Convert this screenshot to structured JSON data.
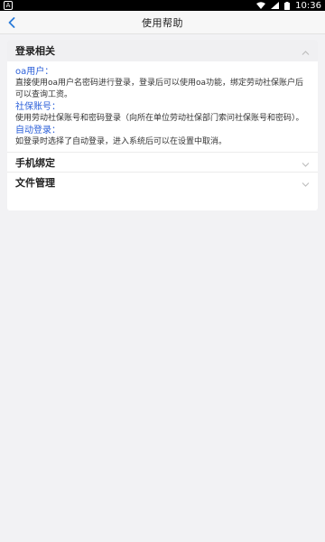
{
  "status_bar": {
    "indicator": "A",
    "time": "10:36",
    "icons": [
      "wifi-icon",
      "signal-icon",
      "battery-icon"
    ]
  },
  "nav": {
    "title": "使用帮助",
    "back_icon": "chevron-left-icon"
  },
  "sections": {
    "login": {
      "title": "登录相关",
      "expanded": true,
      "items": [
        {
          "term": "oa用户：",
          "desc": "直接使用oa用户名密码进行登录，登录后可以使用oa功能，绑定劳动社保账户后可以查询工资。"
        },
        {
          "term": "社保账号：",
          "desc": "使用劳动社保账号和密码登录（向所在单位劳动社保部门索问社保账号和密码）。"
        },
        {
          "term": "自动登录：",
          "desc": "如登录时选择了自动登录，进入系统后可以在设置中取消。"
        }
      ]
    },
    "phone": {
      "title": "手机绑定",
      "expanded": false
    },
    "files": {
      "title": "文件管理",
      "expanded": false
    }
  },
  "colors": {
    "accent": "#2b5fd9",
    "background": "#f2f2f4",
    "card": "#ffffff",
    "header_bg": "#f0f0f2"
  }
}
